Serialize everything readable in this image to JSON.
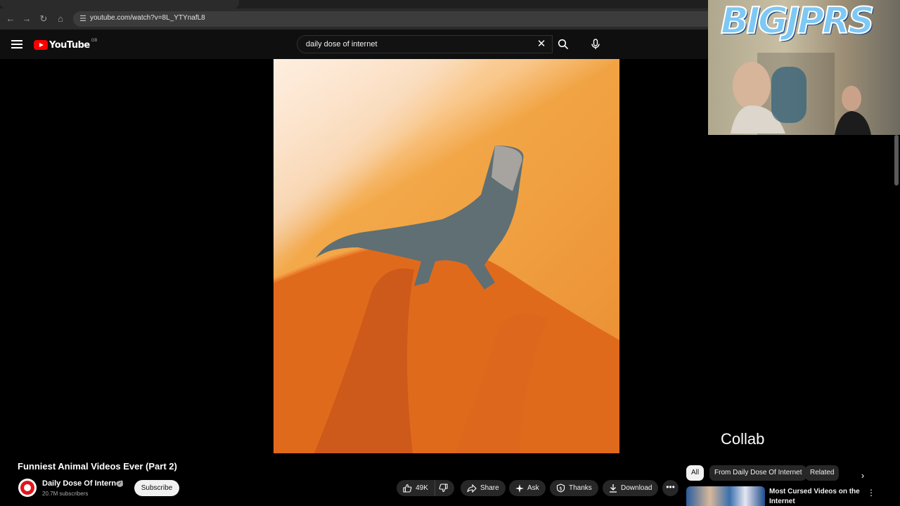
{
  "browser": {
    "url": "youtube.com/watch?v=8L_YTYnafL8",
    "nav_icons": [
      "back-icon",
      "forward-icon",
      "reload-icon",
      "home-icon",
      "site-info-icon"
    ]
  },
  "header": {
    "logo_text": "YouTube",
    "country_code": "GB",
    "search_query": "daily dose of internet"
  },
  "overlay": {
    "webcam_banner": "BIGJPRS",
    "caption": "Collab"
  },
  "video": {
    "title": "Funniest Animal Videos Ever (Part 2)",
    "channel_name": "Daily Dose Of Internet",
    "subscribers": "20.7M subscribers",
    "subscribe_label": "Subscribe"
  },
  "actions": {
    "like_count": "49K",
    "share_label": "Share",
    "ask_label": "Ask",
    "thanks_label": "Thanks",
    "download_label": "Download",
    "more_label": "•••"
  },
  "sidebar": {
    "chips": [
      {
        "label": "All"
      },
      {
        "label": "From Daily Dose Of Internet"
      },
      {
        "label": "Related"
      }
    ],
    "recommendation": {
      "title": "Most Cursed Videos on the Internet"
    }
  },
  "colors": {
    "brand_red": "#ff0000",
    "background": "#0f0f0f",
    "chip_bg": "#272727"
  }
}
